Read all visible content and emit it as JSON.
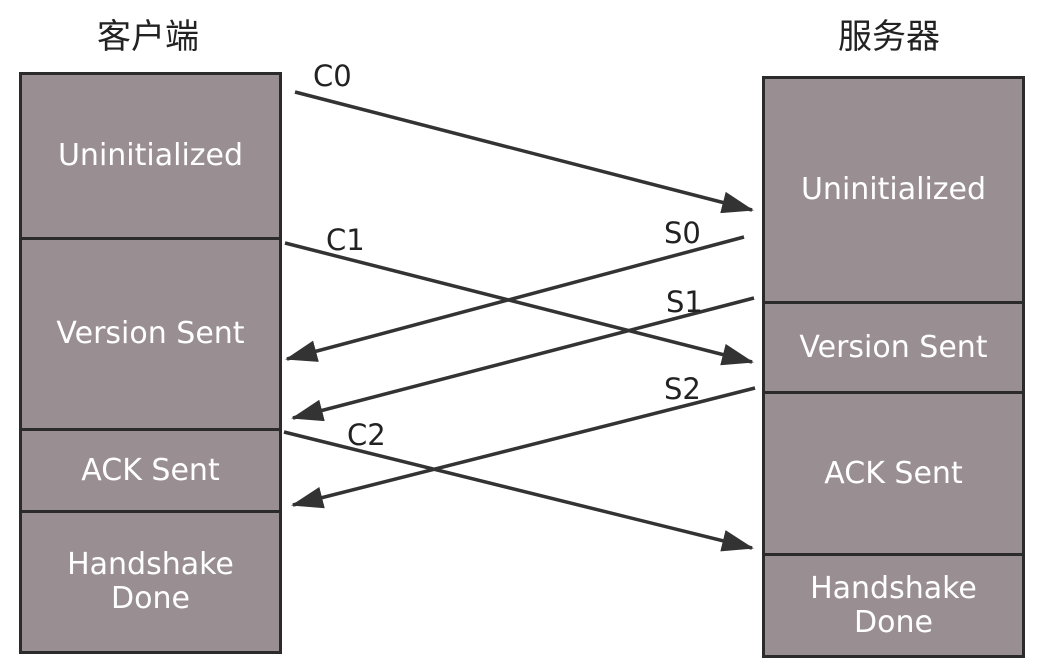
{
  "client": {
    "title": "客户端",
    "states": [
      "Uninitialized",
      "Version Sent",
      "ACK Sent",
      "Handshake Done"
    ]
  },
  "server": {
    "title": "服务器",
    "states": [
      "Uninitialized",
      "Version Sent",
      "ACK Sent",
      "Handshake Done"
    ]
  },
  "messages": [
    {
      "label": "C0",
      "from": "client",
      "to": "server"
    },
    {
      "label": "C1",
      "from": "client",
      "to": "server"
    },
    {
      "label": "S0",
      "from": "server",
      "to": "client"
    },
    {
      "label": "S1",
      "from": "server",
      "to": "client"
    },
    {
      "label": "S2",
      "from": "server",
      "to": "client"
    },
    {
      "label": "C2",
      "from": "client",
      "to": "server"
    }
  ],
  "colors": {
    "state_fill": "#998e91",
    "border": "#2b2b2b",
    "arrow": "#333333",
    "state_text": "#ffffff"
  }
}
